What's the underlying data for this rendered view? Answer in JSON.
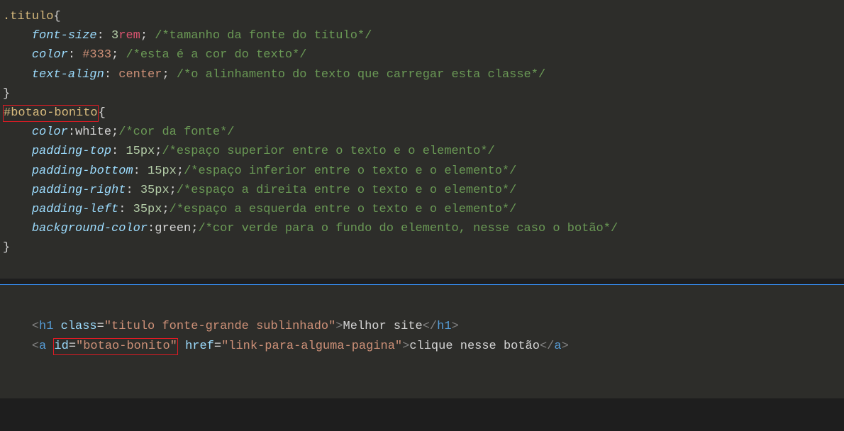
{
  "css": {
    "rule1": {
      "selector": ".titulo",
      "decl1": {
        "prop": "font-size",
        "num": "3",
        "unit": "rem",
        "comment": "/*tamanho da fonte do título*/"
      },
      "decl2": {
        "prop": "color",
        "val": "#333",
        "comment": "/*esta é a cor do texto*/"
      },
      "decl3": {
        "prop": "text-align",
        "val": "center",
        "comment": "/*o alinhamento do texto que carregar esta classe*/"
      }
    },
    "rule2": {
      "selector": "#botao-bonito",
      "decl1": {
        "prop": "color",
        "val": "white",
        "comment": "/*cor da fonte*/"
      },
      "decl2": {
        "prop": "padding-top",
        "num": "15",
        "unit": "px",
        "comment": "/*espaço superior entre o texto e o elemento*/"
      },
      "decl3": {
        "prop": "padding-bottom",
        "num": "15",
        "unit": "px",
        "comment": "/*espaço inferior entre o texto e o elemento*/"
      },
      "decl4": {
        "prop": "padding-right",
        "num": "35",
        "unit": "px",
        "comment": "/*espaço a direita entre o texto e o elemento*/"
      },
      "decl5": {
        "prop": "padding-left",
        "num": "35",
        "unit": "px",
        "comment": "/*espaço a esquerda entre o texto e o elemento*/"
      },
      "decl6": {
        "prop": "background-color",
        "val": "green",
        "comment": "/*cor verde para o fundo do elemento, nesse caso o botão*/"
      }
    }
  },
  "html": {
    "line1": {
      "tag": "h1",
      "attr1name": "class",
      "attr1val": "\"titulo fonte-grande sublinhado\"",
      "text": "Melhor site",
      "closeTag": "h1"
    },
    "line2": {
      "tag": "a",
      "attr1name": "id",
      "attr1val": "\"botao-bonito\"",
      "attr2name": "href",
      "attr2val": "\"link-para-alguma-pagina\"",
      "text": "clique nesse botão",
      "closeTag": "a"
    }
  },
  "glyph": {
    "open": "{",
    "close": "}",
    "lt": "<",
    "gt": ">",
    "ltslash": "</",
    "eq": "=",
    "colon": ":",
    "semi": ";",
    "sp": " ",
    "indent": "    "
  }
}
